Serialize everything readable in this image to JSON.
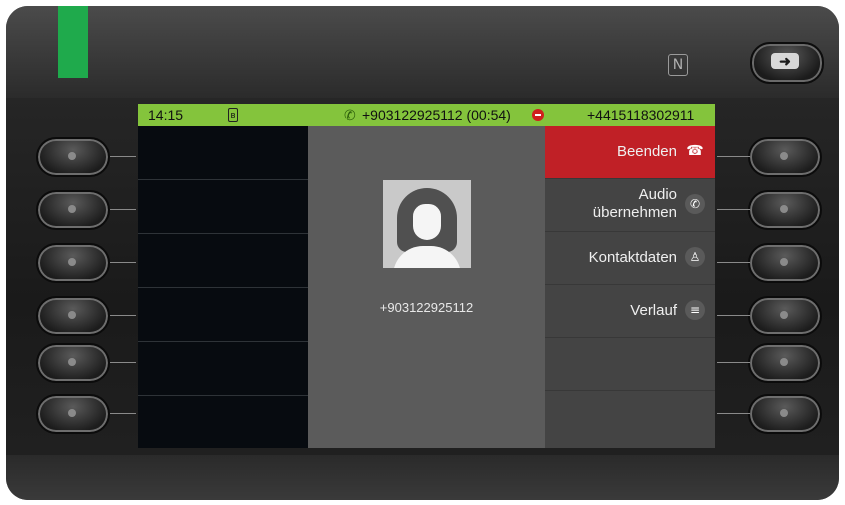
{
  "status": {
    "time": "14:15",
    "bt": "ʙ",
    "call_glyph": "✆",
    "active_call": "+903122925112 (00:54)",
    "own_number": "+4415118302911"
  },
  "caller": {
    "number": "+903122925112"
  },
  "menu": {
    "items": [
      {
        "label": "Beenden",
        "icon": "☎"
      },
      {
        "label_line1": "Audio",
        "label_line2": "übernehmen",
        "icon": "✆"
      },
      {
        "label": "Kontaktdaten",
        "icon": "♙"
      },
      {
        "label": "Verlauf",
        "icon": "≡"
      },
      {
        "label": ""
      },
      {
        "label": ""
      }
    ]
  },
  "hardware": {
    "nfc_label": "N",
    "exit_glyph": "➜"
  },
  "colors": {
    "status_green": "#84c43c",
    "end_red": "#c02026",
    "led_green": "#1faa4c"
  }
}
